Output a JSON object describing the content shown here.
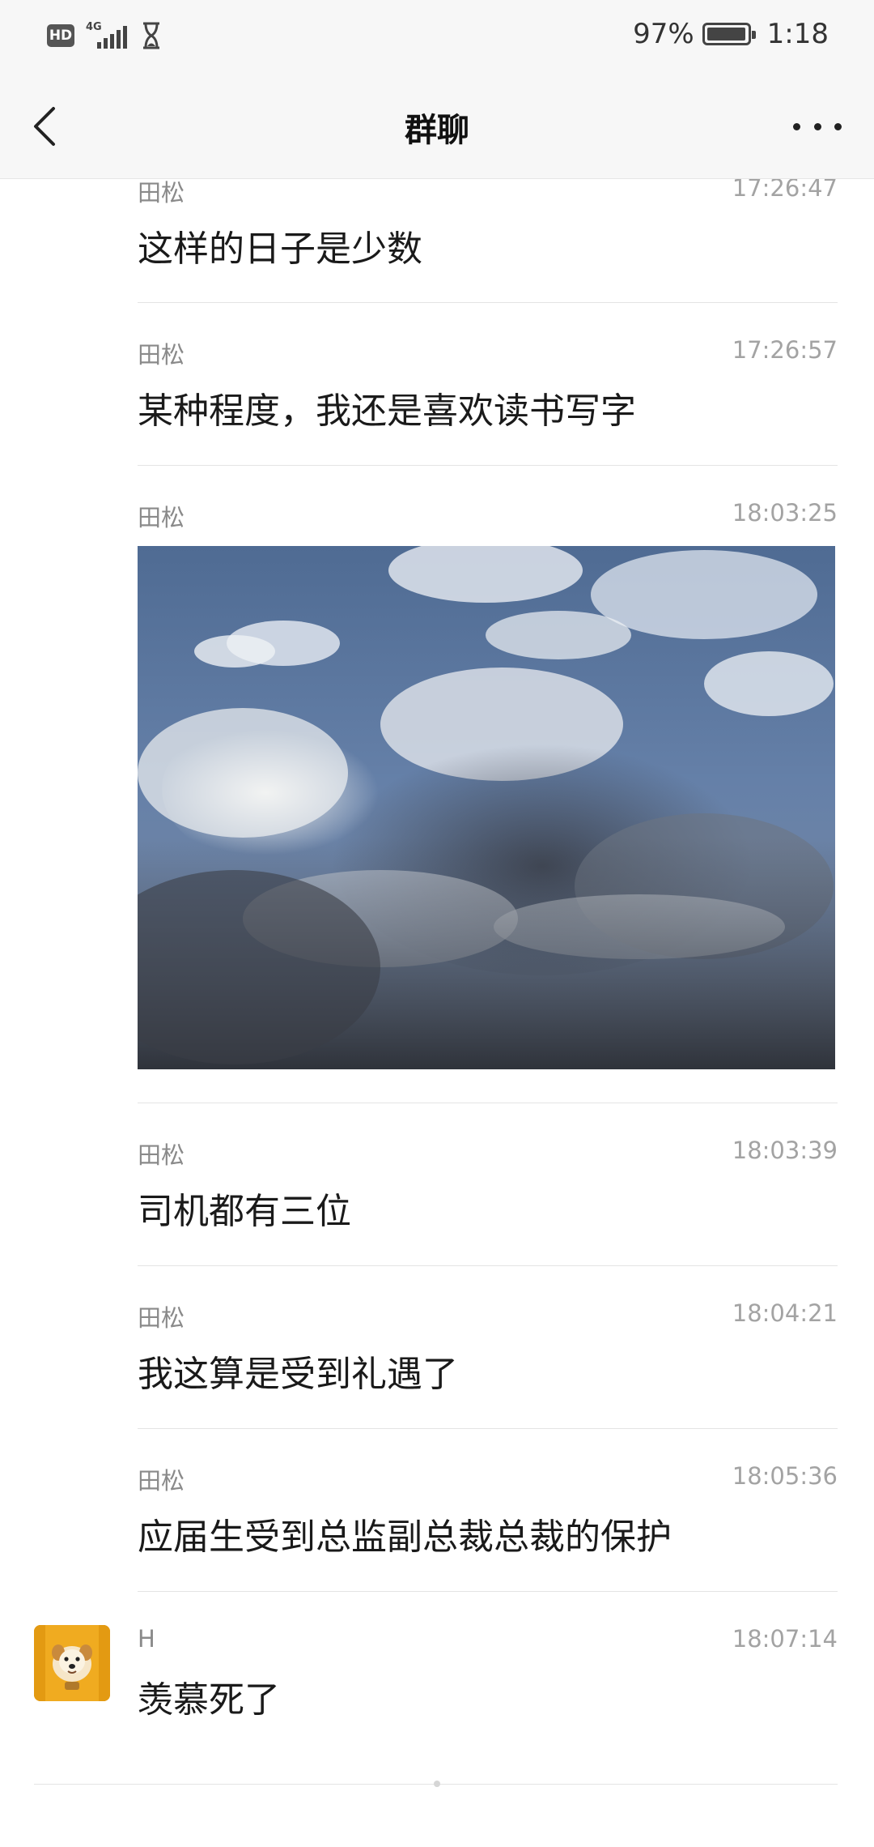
{
  "status_bar": {
    "hd_label": "HD",
    "network_label": "4G",
    "battery_percent": "97%",
    "battery_level": 0.97,
    "time": "1:18"
  },
  "header": {
    "title": "群聊",
    "back_icon": "chevron-left-icon",
    "more_icon": "more-dots-icon"
  },
  "messages": [
    {
      "sender": "田松",
      "time": "17:26:47",
      "text": "这样的日子是少数"
    },
    {
      "sender": "田松",
      "time": "17:26:57",
      "text": "某种程度，我还是喜欢读书写字"
    },
    {
      "sender": "田松",
      "time": "18:03:25",
      "image": "sky-clouds-photo"
    },
    {
      "sender": "田松",
      "time": "18:03:39",
      "text": "司机都有三位"
    },
    {
      "sender": "田松",
      "time": "18:04:21",
      "text": "我这算是受到礼遇了"
    },
    {
      "sender": "田松",
      "time": "18:05:36",
      "text": "应届生受到总监副总裁总裁的保护"
    },
    {
      "sender": "H",
      "time": "18:07:14",
      "text": "羡慕死了",
      "avatar": "dog-avatar"
    }
  ],
  "colors": {
    "header_bg": "#f7f7f7",
    "name_text": "#8a8a8a",
    "time_text": "#a3a3a3",
    "avatar_bg": "#f0ab20"
  }
}
